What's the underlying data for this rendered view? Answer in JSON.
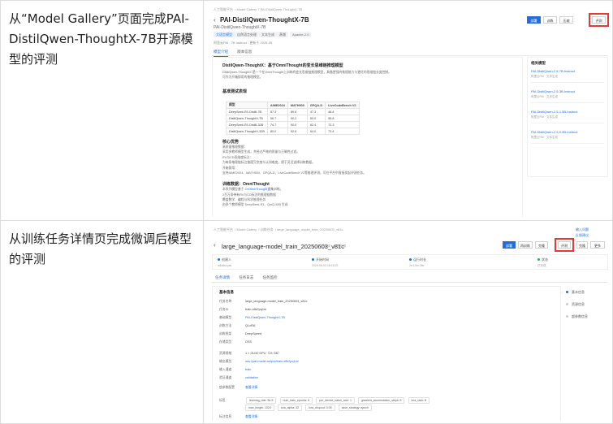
{
  "rows": [
    {
      "description": "从“Model Gallery”页面完成PAI-DistilQwen-ThoughtX-7B开源模型的评测",
      "screenshot": {
        "breadcrumb": [
          "人工智能平台",
          "Model Gallery",
          "PAI-DistilQwen-ThoughtX-7B"
        ],
        "title": "PAI-DistilQwen-ThoughtX-7B",
        "subtitle": "PAI-DistilQwen-ThoughtX-7B",
        "tags": [
          "大语言模型",
          "自然语言处理",
          "文本生成",
          "蒸馏",
          "Apache-2.0"
        ],
        "meta": "阿里云PAI · 7B Instruct · 更新于 2025-05",
        "buttons": {
          "deploy": "部署",
          "finetune": "训练",
          "compress": "压缩",
          "evaluate": "评测"
        },
        "tabs": [
          "模型介绍",
          "版本信息"
        ],
        "heading": "DistilQwen-ThoughtX：基于OmniThought的变长思维链推理模型",
        "intro_lines": [
          "DistilQwen-ThoughtX 是一个在OmniThought上训练的变长思维链推理模型，具备更强的推理能力与更优的思维链长度控制。",
          "可作为开箱即用的推理模型。"
        ],
        "table_heading": "基准测试表现",
        "table": {
          "headers": [
            "模型",
            "AIME2024",
            "MATH500",
            "GPQA-D",
            "LiveCodeBench V2"
          ],
          "rows": [
            [
              "DeepSeek-R1-Distill-7B",
              "57.3",
              "89.6",
              "47.3",
              "48.4"
            ],
            [
              "DistilQwen-ThoughtX-7B",
              "56.7",
              "90.2",
              "50.0",
              "55.8"
            ],
            [
              "DeepSeek-R1-Distill-32B",
              "74.7",
              "90.0",
              "62.4",
              "72.3"
            ],
            [
              "DistilQwen-ThoughtX-32B",
              "80.0",
              "92.6",
              "64.0",
              "73.4"
            ]
          ]
        },
        "section2_heading": "核心优势",
        "section2_lines": [
          "高质量推理数据：",
          "采用多教师模型生成，并经过严格的质量与正确性过滤。",
          "RV与CD双维度标注：",
          "为每条推理链标注推理冗余度与认知难度，便于灵活选择训练数据。",
          "开箱即用：",
          "支持AIME2024、MATH500、GPQA-D、LiveCodeBench V2等推理评测，可在平台中直接发起评测任务。"
        ],
        "section3_heading": "训练数据：OmniThought",
        "section3_link_text": "OmniThought",
        "section3_lines": [
          "本系列模型基于 OmniThought 数据集训练。",
          "2百万条带有RV与CD标注的推理链数据",
          "覆盖数学、编程与科学推理任务",
          "由多个教师模型 DeepSeek-R1、QwQ-32B 生成"
        ],
        "side_title": "相关模型",
        "side_items": [
          {
            "name": "PAI-DistilQwen-2.5-7B-Instruct",
            "meta": "阿里云PAI · 文本生成"
          },
          {
            "name": "PAI-DistilQwen-2.5-3B-Instruct",
            "meta": "阿里云PAI · 文本生成"
          },
          {
            "name": "PAI-DistilQwen-2.5-1.5B-Instruct",
            "meta": "阿里云PAI · 文本生成"
          },
          {
            "name": "PAI-DistilQwen-2.5-0.5B-Instruct",
            "meta": "阿里云PAI · 文本生成"
          }
        ]
      }
    },
    {
      "description": "从训练任务详情页完成微调后模型的评测",
      "screenshot": {
        "breadcrumb": [
          "人工智能平台",
          "Model Gallery",
          "训练任务",
          "large_language_model_train_20250603_v81c"
        ],
        "title": "large_language-model_train_20250603_v81c",
        "title_badge": "已完成 · 训练任务",
        "top_right_links": [
          "输入问题",
          "反馈建议"
        ],
        "buttons": {
          "deploy": "部署",
          "retrain": "再训练",
          "evaluate": "评测",
          "clone": "克隆",
          "more": "更多"
        },
        "summary": [
          {
            "label": "创建人",
            "value": "alibaba-pai"
          },
          {
            "label": "开始时间",
            "value": "2025-06-03 18:16:22"
          },
          {
            "label": "运行时长",
            "value": "2h 14m 08s"
          },
          {
            "label": "状态",
            "value": "已完成"
          }
        ],
        "tabs": [
          "任务详情",
          "任务日志",
          "任务监控"
        ],
        "form_section_title": "基本信息",
        "form_rows": [
          {
            "label": "任务名称",
            "value": "large_language-model_train_20250603_v81c",
            "link": false
          },
          {
            "label": "任务ID",
            "value": "train-x8k2pq1m",
            "link": false
          },
          {
            "label": "基础模型",
            "value": "PAI-DistilQwen-ThoughtX-7B",
            "link": true
          },
          {
            "label": "训练方法",
            "value": "QLoRA",
            "link": false
          },
          {
            "label": "训练框架",
            "value": "DeepSpeed",
            "link": false
          },
          {
            "label": "存储类型",
            "value": "OSS",
            "link": false
          },
          {
            "label": "资源规格",
            "value": "1 × GU30 GPU（24 GB）",
            "link": false
          },
          {
            "label": "输出模型",
            "value": "oss://pai-model-output/train-x8k2pq1m/",
            "link": true
          },
          {
            "label": "输入通道",
            "value": "train",
            "link": true
          },
          {
            "label": "验证通道",
            "value": "validation",
            "link": true
          },
          {
            "label": "超参数配置",
            "value": "查看详情",
            "link": true
          }
        ],
        "hyper_label": "标签",
        "hyper_chips_row1": [
          "learning_rate: 5e-5",
          "num_train_epochs: 6",
          "per_device_batch_size: 1",
          "gradient_accumulation_steps: 8",
          "lora_rank: 8"
        ],
        "hyper_chips_row2": [
          "max_length: 1024",
          "lora_alpha: 32",
          "lora_dropout: 0.05",
          "save_strategy: epoch"
        ],
        "output_row": {
          "label": "标注信息",
          "value": "查看详情"
        },
        "anchors": [
          "基本信息",
          "资源信息",
          "超参数信息"
        ]
      }
    }
  ]
}
